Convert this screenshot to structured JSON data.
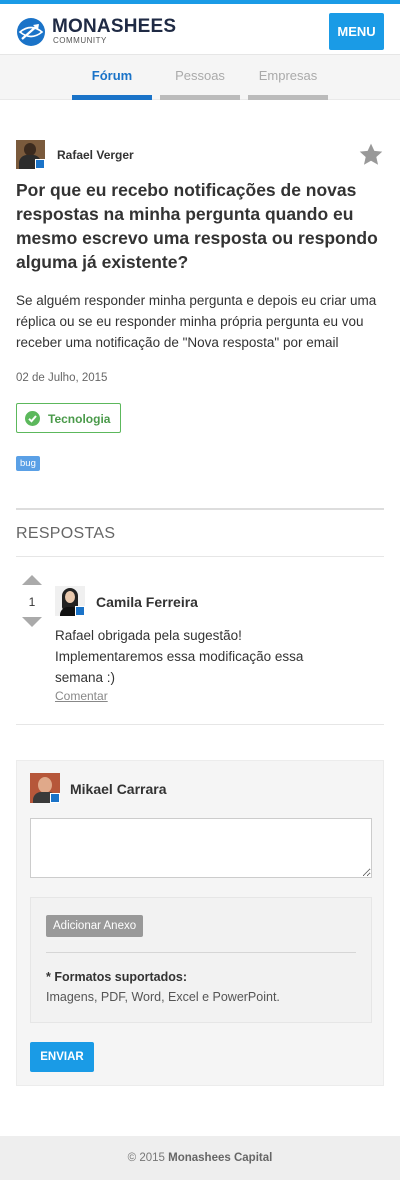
{
  "colors": {
    "accent": "#1a9be6",
    "active_tab": "#1a73c8",
    "category_green": "#5cb85c",
    "tag_blue": "#5aa0e6"
  },
  "header": {
    "logo_icon": "globe-arrow-icon",
    "brand_name": "MONASHEES",
    "brand_sub": "COMMUNITY",
    "menu_label": "MENU"
  },
  "tabs": [
    {
      "label": "Fórum",
      "active": true
    },
    {
      "label": "Pessoas",
      "active": false
    },
    {
      "label": "Empresas",
      "active": false
    }
  ],
  "question": {
    "author": "Rafael Verger",
    "favorite_icon": "star-icon",
    "title": "Por que eu recebo notificações de novas respostas na minha pergunta quando eu mesmo escrevo uma resposta ou respondo alguma já existente?",
    "body": "Se alguém responder minha pergunta e depois eu criar uma réplica ou se eu responder minha própria pergunta eu vou receber uma notificação de \"Nova resposta\" por email",
    "date": "02 de Julho, 2015",
    "category": "Tecnologia",
    "tag": "bug"
  },
  "answers_section": {
    "title": "RESPOSTAS",
    "answers": [
      {
        "votes": "1",
        "author": "Camila Ferreira",
        "body": "Rafael obrigada pela sugestão! Implementaremos essa modificação essa semana :)",
        "comment_label": "Comentar"
      }
    ]
  },
  "reply": {
    "author": "Mikael Carrara",
    "textarea_value": "",
    "attach_label": "Adicionar Anexo",
    "formats_title": "* Formatos suportados:",
    "formats_list": "Imagens, PDF, Word, Excel e PowerPoint.",
    "send_label": "ENVIAR"
  },
  "footer": {
    "copyright": "© 2015",
    "company": "Monashees Capital"
  }
}
